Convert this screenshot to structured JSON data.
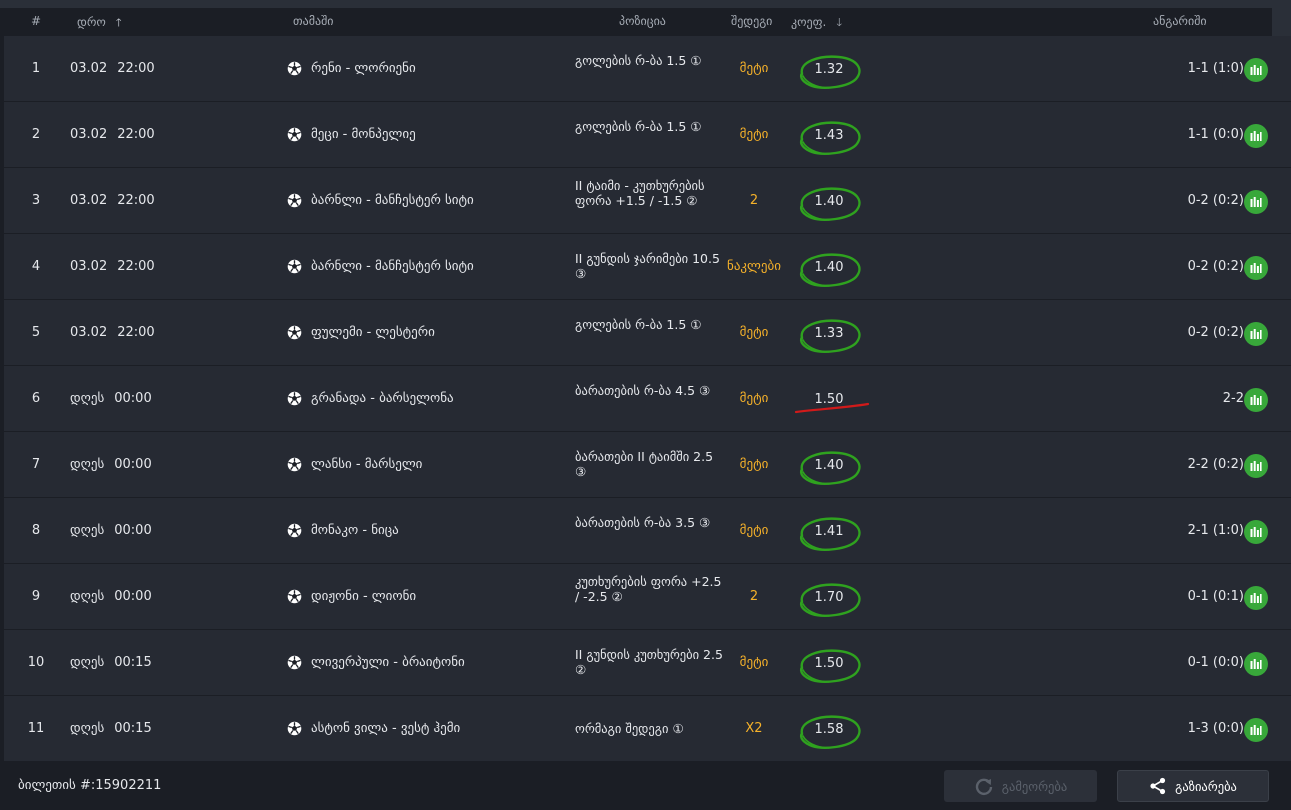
{
  "header": {
    "num": "#",
    "time": "დრო",
    "game": "თამაში",
    "position": "პოზიცია",
    "outcome": "შედეგი",
    "odds": "კოეფ.",
    "score": "ანგარიში"
  },
  "rows": [
    {
      "num": "1",
      "date": "03.02",
      "time": "22:00",
      "match": "რენი - ლორიენი",
      "pos": "გოლების რ-ბა 1.5 ①",
      "outcome": "მეტი",
      "odds": "1.32",
      "score": "1-1 (1:0)",
      "mark": "won"
    },
    {
      "num": "2",
      "date": "03.02",
      "time": "22:00",
      "match": "მეცი - მონპელიე",
      "pos": "გოლების რ-ბა 1.5 ①",
      "outcome": "მეტი",
      "odds": "1.43",
      "score": "1-1 (0:0)",
      "mark": "won"
    },
    {
      "num": "3",
      "date": "03.02",
      "time": "22:00",
      "match": "ბარნლი - მანჩესტერ სიტი",
      "pos": "II ტაიმი - კუთხურების ფორა +1.5 / -1.5 ②",
      "outcome": "2",
      "odds": "1.40",
      "score": "0-2 (0:2)",
      "mark": "won"
    },
    {
      "num": "4",
      "date": "03.02",
      "time": "22:00",
      "match": "ბარნლი - მანჩესტერ სიტი",
      "pos": "II გუნდის ჯარიმები 10.5 ③",
      "outcome": "ნაკლები",
      "odds": "1.40",
      "score": "0-2 (0:2)",
      "mark": "won"
    },
    {
      "num": "5",
      "date": "03.02",
      "time": "22:00",
      "match": "ფულემი - ლესტერი",
      "pos": "გოლების რ-ბა 1.5 ①",
      "outcome": "მეტი",
      "odds": "1.33",
      "score": "0-2 (0:2)",
      "mark": "won"
    },
    {
      "num": "6",
      "date": "დღეს",
      "time": "00:00",
      "match": "გრანადა - ბარსელონა",
      "pos": "ბარათების რ-ბა 4.5 ③",
      "outcome": "მეტი",
      "odds": "1.50",
      "score": "2-2",
      "mark": "pending"
    },
    {
      "num": "7",
      "date": "დღეს",
      "time": "00:00",
      "match": "ლანსი - მარსელი",
      "pos": "ბარათები II ტაიმში 2.5 ③",
      "outcome": "მეტი",
      "odds": "1.40",
      "score": "2-2 (0:2)",
      "mark": "won"
    },
    {
      "num": "8",
      "date": "დღეს",
      "time": "00:00",
      "match": "მონაკო - ნიცა",
      "pos": "ბარათების რ-ბა 3.5 ③",
      "outcome": "მეტი",
      "odds": "1.41",
      "score": "2-1 (1:0)",
      "mark": "won"
    },
    {
      "num": "9",
      "date": "დღეს",
      "time": "00:00",
      "match": "დიჟონი - ლიონი",
      "pos": "კუთხურების ფორა +2.5 / -2.5 ②",
      "outcome": "2",
      "odds": "1.70",
      "score": "0-1 (0:1)",
      "mark": "won"
    },
    {
      "num": "10",
      "date": "დღეს",
      "time": "00:15",
      "match": "ლივერპული - ბრაიტონი",
      "pos": "II გუნდის კუთხურები 2.5 ②",
      "outcome": "მეტი",
      "odds": "1.50",
      "score": "0-1 (0:0)",
      "mark": "won"
    },
    {
      "num": "11",
      "date": "დღეს",
      "time": "00:15",
      "match": "ასტონ ვილა - ვესტ ჰემი",
      "pos": "ორმაგი შედეგი ①",
      "outcome": "X2",
      "odds": "1.58",
      "score": "1-3 (0:0)",
      "mark": "won"
    }
  ],
  "footer": {
    "ticket": "ბილეთის #:15902211",
    "repeat_label": "გამეორება",
    "share_label": "გაზიარება"
  },
  "colors": {
    "accent_outcome": "#f5b12a",
    "won_circle": "#2fa21f",
    "pending_line": "#d11a1a",
    "stats_button": "#38a83a"
  },
  "icons": {
    "sport": "soccer-ball-icon",
    "stats": "bar-chart-icon",
    "repeat": "refresh-icon",
    "share": "share-icon"
  }
}
